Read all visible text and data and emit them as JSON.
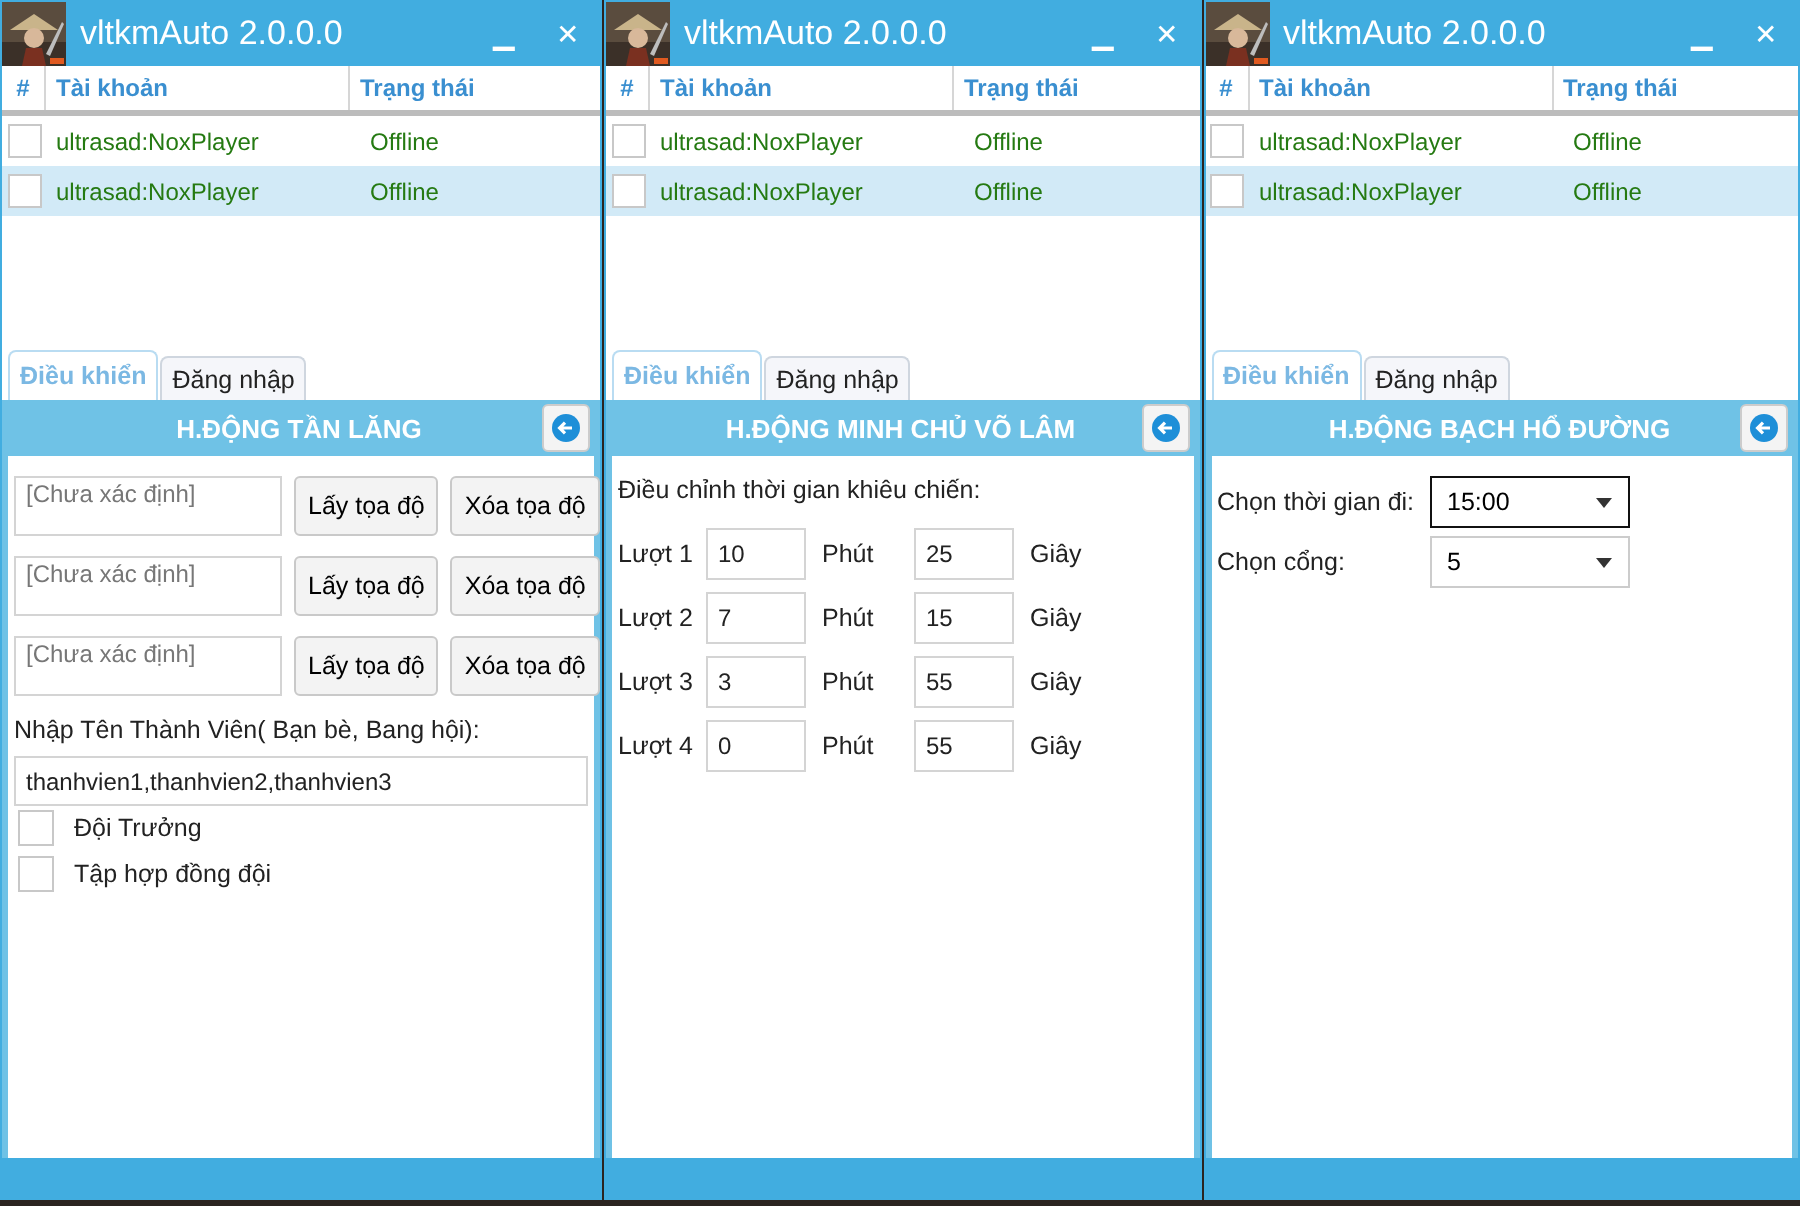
{
  "windows": [
    {
      "title": "vltkmAuto 2.0.0.0",
      "minimize": "▁",
      "close": "✕",
      "table": {
        "columns": [
          "#",
          "Tài khoản",
          "Trạng thái"
        ],
        "rows": [
          {
            "account": "ultrasad:NoxPlayer",
            "status": "Offline",
            "checked": false,
            "selected": false
          },
          {
            "account": "ultrasad:NoxPlayer",
            "status": "Offline",
            "checked": false,
            "selected": true
          }
        ]
      },
      "tabs": [
        {
          "label": "Điều khiển",
          "selected": true
        },
        {
          "label": "Đăng nhập",
          "selected": false
        }
      ],
      "panel": {
        "kind": "coordinates",
        "title": "H.ĐỘNG TẦN LĂNG",
        "points": [
          {
            "placeholder": "[Chưa xác định]",
            "get": "Lấy tọa độ",
            "clear": "Xóa tọa độ"
          },
          {
            "placeholder": "[Chưa xác định]",
            "get": "Lấy tọa độ",
            "clear": "Xóa tọa độ"
          },
          {
            "placeholder": "[Chưa xác định]",
            "get": "Lấy tọa độ",
            "clear": "Xóa tọa độ"
          }
        ],
        "member_label": "Nhập Tên Thành Viên( Bạn bè, Bang hội):",
        "member_value": "thanhvien1,thanhvien2,thanhvien3",
        "options": [
          {
            "label": "Đội Trưởng",
            "checked": false
          },
          {
            "label": "Tập hợp đồng đội",
            "checked": false
          }
        ]
      }
    },
    {
      "title": "vltkmAuto 2.0.0.0",
      "minimize": "▁",
      "close": "✕",
      "table": {
        "columns": [
          "#",
          "Tài khoản",
          "Trạng thái"
        ],
        "rows": [
          {
            "account": "ultrasad:NoxPlayer",
            "status": "Offline",
            "checked": false,
            "selected": false
          },
          {
            "account": "ultrasad:NoxPlayer",
            "status": "Offline",
            "checked": false,
            "selected": true
          }
        ]
      },
      "tabs": [
        {
          "label": "Điều khiển",
          "selected": true
        },
        {
          "label": "Đăng nhập",
          "selected": false
        }
      ],
      "panel": {
        "kind": "rounds",
        "title": "H.ĐỘNG MINH CHỦ VÕ LÂM",
        "heading": "Điều chỉnh thời gian khiêu chiến:",
        "rounds": [
          {
            "label": "Lượt 1",
            "minutes": "10",
            "minute_unit": "Phút",
            "seconds": "25",
            "second_unit": "Giây"
          },
          {
            "label": "Lượt 2",
            "minutes": "7",
            "minute_unit": "Phút",
            "seconds": "15",
            "second_unit": "Giây"
          },
          {
            "label": "Lượt 3",
            "minutes": "3",
            "minute_unit": "Phút",
            "seconds": "55",
            "second_unit": "Giây"
          },
          {
            "label": "Lượt 4",
            "minutes": "0",
            "minute_unit": "Phút",
            "seconds": "55",
            "second_unit": "Giây"
          }
        ]
      }
    },
    {
      "title": "vltkmAuto 2.0.0.0",
      "minimize": "▁",
      "close": "✕",
      "table": {
        "columns": [
          "#",
          "Tài khoản",
          "Trạng thái"
        ],
        "rows": [
          {
            "account": "ultrasad:NoxPlayer",
            "status": "Offline",
            "checked": false,
            "selected": false
          },
          {
            "account": "ultrasad:NoxPlayer",
            "status": "Offline",
            "checked": false,
            "selected": true
          }
        ]
      },
      "tabs": [
        {
          "label": "Điều khiển",
          "selected": true
        },
        {
          "label": "Đăng nhập",
          "selected": false
        }
      ],
      "panel": {
        "kind": "schedule",
        "title": "H.ĐỘNG BẠCH HỔ ĐƯỜNG",
        "dropdowns": [
          {
            "label": "Chọn thời gian đi:",
            "value": "15:00",
            "focused": true
          },
          {
            "label": "Chọn cổng:",
            "value": "5",
            "focused": false
          }
        ]
      }
    }
  ]
}
